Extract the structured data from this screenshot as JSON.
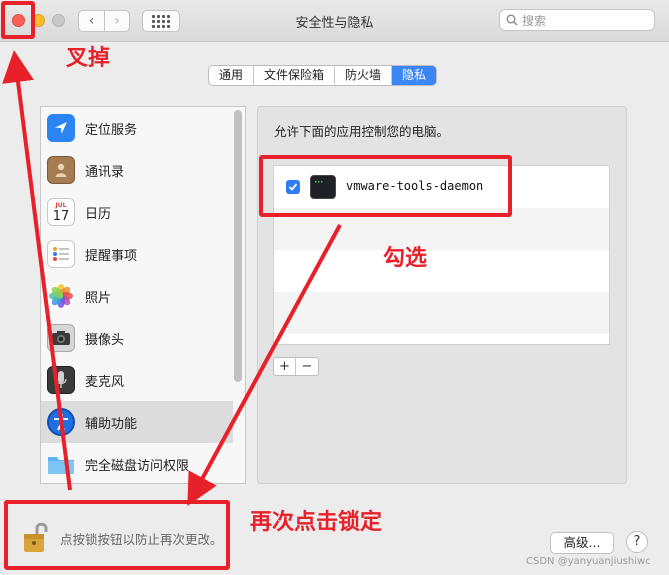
{
  "window": {
    "title": "安全性与隐私",
    "search_placeholder": "搜索"
  },
  "tabs": [
    {
      "label": "通用",
      "active": false
    },
    {
      "label": "文件保险箱",
      "active": false
    },
    {
      "label": "防火墙",
      "active": false
    },
    {
      "label": "隐私",
      "active": true
    }
  ],
  "sidebar": {
    "items": [
      {
        "label": "定位服务",
        "icon": "location-icon"
      },
      {
        "label": "通讯录",
        "icon": "contacts-icon"
      },
      {
        "label": "日历",
        "icon": "calendar-icon",
        "icon_text_month": "JUL",
        "icon_text_day": "17"
      },
      {
        "label": "提醒事项",
        "icon": "reminders-icon"
      },
      {
        "label": "照片",
        "icon": "photos-icon"
      },
      {
        "label": "摄像头",
        "icon": "camera-icon"
      },
      {
        "label": "麦克风",
        "icon": "microphone-icon"
      },
      {
        "label": "辅助功能",
        "icon": "accessibility-icon",
        "selected": true
      },
      {
        "label": "完全磁盘访问权限",
        "icon": "folder-icon"
      }
    ]
  },
  "content": {
    "description": "允许下面的应用控制您的电脑。",
    "apps": [
      {
        "name": "vmware-tools-daemon",
        "checked": true
      }
    ],
    "add_label": "+",
    "remove_label": "−"
  },
  "footer": {
    "lock_text": "点按锁按钮以防止再次更改。",
    "advanced_label": "高级...",
    "help_label": "?",
    "watermark": "CSDN @yanyuanjiushiwc"
  },
  "annotations": {
    "close_note": "叉掉",
    "check_note": "勾选",
    "lock_note": "再次点击锁定",
    "color": "#e8202a"
  }
}
